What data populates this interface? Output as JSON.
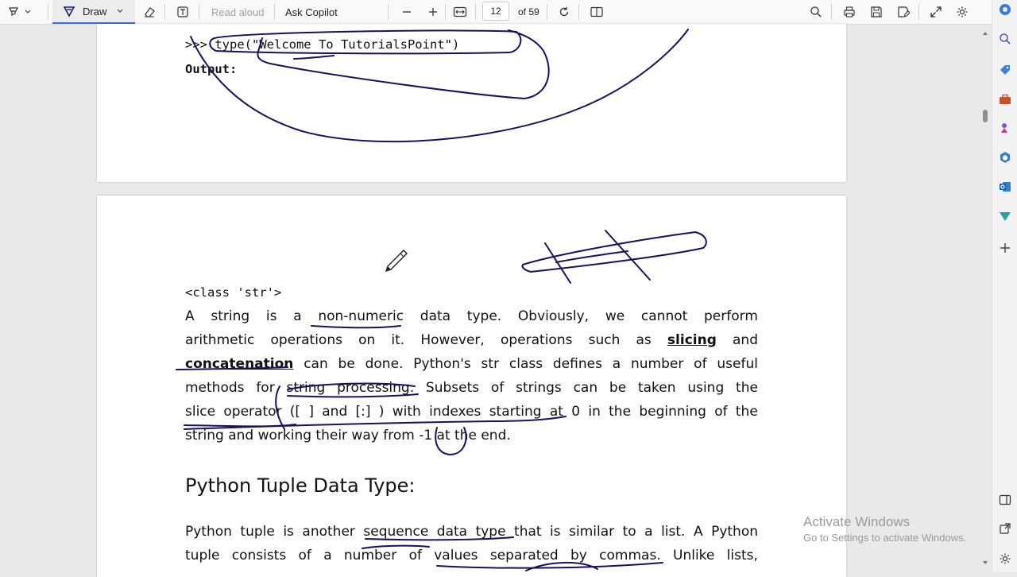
{
  "toolbar": {
    "draw_label": "Draw",
    "read_aloud_label": "Read aloud",
    "ask_copilot_label": "Ask Copilot",
    "page_current": "12",
    "page_total": "of 59",
    "ink_color": "#1b0f5e"
  },
  "page_top": {
    "prompt": ">>> ",
    "code": "type(\"Welcome To TutorialsPoint\")",
    "output_label": "Output:"
  },
  "page_main": {
    "class_output": "<class 'str'>",
    "paragraph1": {
      "line1": [
        "A",
        "string",
        "is",
        "a",
        "non-numeric",
        "data",
        "type.",
        "Obviously,",
        "we",
        "cannot",
        "perform"
      ],
      "line2_pre": [
        "arithmetic",
        "operations",
        "on",
        "it.",
        "However,",
        "operations",
        "such",
        "as"
      ],
      "line2_bold": "slicing",
      "line2_post": "and",
      "line3_bold": "concatenation",
      "line3_rest": [
        "can",
        "be",
        "done.",
        "Python's",
        "str",
        "class",
        "defines",
        "a",
        "number",
        "of",
        "useful"
      ],
      "line4": [
        "methods",
        "for",
        "string",
        "processing.",
        "Subsets",
        "of",
        "strings",
        "can",
        "be",
        "taken",
        "using",
        "the"
      ],
      "line5": [
        "slice",
        "operator",
        "([",
        "]",
        "and",
        "[:]",
        ")",
        "with",
        "indexes",
        "starting",
        "at",
        "0",
        "in",
        "the",
        "beginning",
        "of",
        "the"
      ],
      "line6": "string and working their way from -1 at the end."
    },
    "heading": "Python Tuple Data Type:",
    "paragraph2": {
      "line1": [
        "Python",
        "tuple",
        "is",
        "another",
        "sequence",
        "data",
        "type",
        "that",
        "is",
        "similar",
        "to",
        "a",
        "list.",
        "A",
        "Python"
      ],
      "line2": [
        "tuple",
        "consists",
        "of",
        "a",
        "number",
        "of",
        "values",
        "separated",
        "by",
        "commas.",
        "Unlike",
        "lists,"
      ]
    }
  },
  "watermark": {
    "title": "Activate Windows",
    "subtitle": "Go to Settings to activate Windows."
  }
}
